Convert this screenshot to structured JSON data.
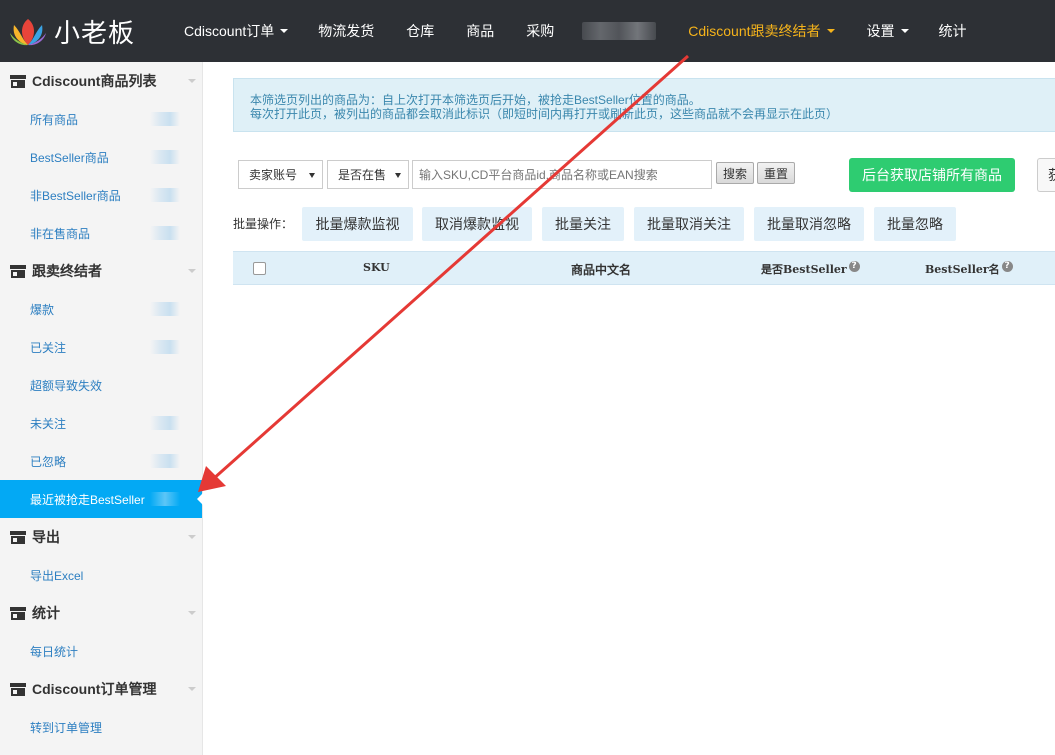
{
  "brand": {
    "name": "小老板"
  },
  "nav": {
    "items": [
      {
        "label": "Cdiscount订单",
        "dropdown": true,
        "active": false
      },
      {
        "label": "物流发货",
        "dropdown": false,
        "active": false
      },
      {
        "label": "仓库",
        "dropdown": false,
        "active": false
      },
      {
        "label": "商品",
        "dropdown": false,
        "active": false
      },
      {
        "label": "采购",
        "dropdown": false,
        "active": false
      },
      {
        "label": "Cdiscount跟卖终结者",
        "dropdown": true,
        "active": true
      },
      {
        "label": "设置",
        "dropdown": true,
        "active": false
      },
      {
        "label": "统计",
        "dropdown": false,
        "active": false
      }
    ]
  },
  "sidebar": {
    "groups": [
      {
        "title": "Cdiscount商品列表",
        "items": [
          "所有商品",
          "BestSeller商品",
          "非BestSeller商品",
          "非在售商品"
        ]
      },
      {
        "title": "跟卖终结者",
        "items": [
          "爆款",
          "已关注",
          "超额导致失效",
          "未关注",
          "已忽略",
          "最近被抢走BestSeller"
        ]
      },
      {
        "title": "导出",
        "items": [
          "导出Excel"
        ]
      },
      {
        "title": "统计",
        "items": [
          "每日统计"
        ]
      },
      {
        "title": "Cdiscount订单管理",
        "items": [
          "转到订单管理"
        ]
      }
    ],
    "active_item": "最近被抢走BestSeller"
  },
  "notice": {
    "line1": "本筛选页列出的商品为：自上次打开本筛选页后开始，被抢走BestSeller位置的商品。",
    "line2": "每次打开此页，被列出的商品都会取消此标识（即短时间内再打开或刷新此页，这些商品就不会再显示在此页）"
  },
  "filters": {
    "seller_account": "卖家账号",
    "on_sale": "是否在售",
    "search_placeholder": "输入SKU,CD平台商品id,商品名称或EAN搜索",
    "search_label": "搜索",
    "reset_label": "重置",
    "fetch_all_label": "后台获取店铺所有商品",
    "cut_button_label": "获"
  },
  "batch": {
    "label": "批量操作：",
    "buttons": [
      "批量爆款监视",
      "取消爆款监视",
      "批量关注",
      "批量取消关注",
      "批量取消忽略",
      "批量忽略"
    ]
  },
  "table": {
    "headers": {
      "sku": "SKU",
      "name": "商品中文名",
      "is_bestseller": "是否BestSeller",
      "bestseller_name": "BestSeller名"
    }
  },
  "colors": {
    "nav_bg": "#2d3035",
    "nav_active": "#f5b31b",
    "sidebar_active": "#03a9f4",
    "link": "#2d7fc1",
    "green_button": "#2ecc71",
    "annotation_arrow": "#e53935"
  }
}
